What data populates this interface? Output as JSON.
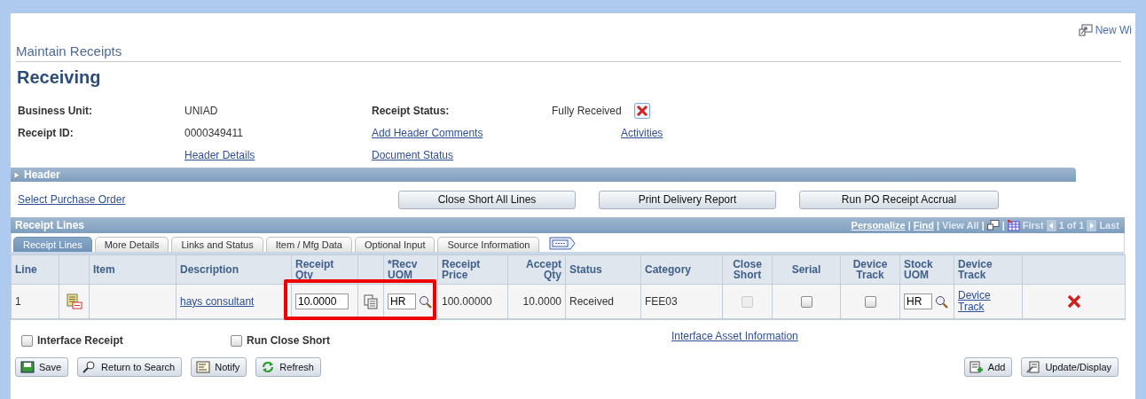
{
  "new_window": "New Wi",
  "breadcrumb": "Maintain Receipts",
  "title": "Receiving",
  "header_fields": {
    "business_unit": {
      "label": "Business Unit:",
      "value": "UNIAD"
    },
    "receipt_status": {
      "label": "Receipt Status:",
      "value": "Fully Received"
    },
    "receipt_id": {
      "label": "Receipt ID:",
      "value": "0000349411"
    },
    "add_header_comments": "Add Header Comments",
    "activities": "Activities",
    "header_details": "Header Details",
    "document_status": "Document Status"
  },
  "header_section": {
    "label": "Header",
    "expanded": false
  },
  "select_po": "Select Purchase Order",
  "action_buttons": [
    "Close Short All Lines",
    "Print Delivery Report",
    "Run PO Receipt Accrual"
  ],
  "grid": {
    "title": "Receipt Lines",
    "nav": [
      {
        "kind": "link",
        "text": "Personalize"
      },
      {
        "kind": "sep",
        "text": "|"
      },
      {
        "kind": "link",
        "text": "Find"
      },
      {
        "kind": "sep",
        "text": "|"
      },
      {
        "kind": "muted",
        "text": "View All"
      },
      {
        "kind": "sep",
        "text": "|"
      },
      {
        "kind": "zoom"
      },
      {
        "kind": "sep",
        "text": "|"
      },
      {
        "kind": "grid"
      },
      {
        "kind": "muted",
        "text": "First"
      },
      {
        "kind": "prev"
      },
      {
        "kind": "muted",
        "text": "1 of 1"
      },
      {
        "kind": "next"
      },
      {
        "kind": "muted",
        "text": "Last"
      }
    ],
    "tabs": [
      {
        "label": "Receipt Lines",
        "selected": true
      },
      {
        "label": "More Details",
        "selected": false
      },
      {
        "label": "Links and Status",
        "selected": false
      },
      {
        "label": "Item / Mfg Data",
        "selected": false
      },
      {
        "label": "Optional Input",
        "selected": false
      },
      {
        "label": "Source Information",
        "selected": false
      }
    ],
    "columns": [
      {
        "label": "Line"
      },
      {},
      {
        "label": "Item"
      },
      {
        "label": "Description"
      },
      {
        "label": "Receipt Qty"
      },
      {},
      {
        "label": "*Recv UOM"
      },
      {
        "label": "Receipt Price"
      },
      {
        "label": "Accept Qty"
      },
      {
        "label": "Status"
      },
      {
        "label": "Category"
      },
      {
        "label": "Close Short"
      },
      {
        "label": "Serial"
      },
      {
        "label": "Device Track"
      },
      {
        "label": "Stock UOM"
      },
      {
        "label": "Device Track"
      },
      {}
    ],
    "rows": [
      [
        {
          "kind": "text",
          "text": "1"
        },
        {
          "kind": "detail"
        },
        {
          "kind": "empty"
        },
        {
          "kind": "link",
          "text": "hays consultant"
        },
        {
          "kind": "input",
          "value": "10.0000"
        },
        {
          "kind": "copy"
        },
        {
          "kind": "lookup",
          "value": "HR"
        },
        {
          "kind": "text",
          "text": "100.00000"
        },
        {
          "kind": "text",
          "text": "10.0000"
        },
        {
          "kind": "text",
          "text": "Received"
        },
        {
          "kind": "text",
          "text": "FEE03"
        },
        {
          "kind": "checkbox",
          "checked": false,
          "disabled": true
        },
        {
          "kind": "checkbox",
          "checked": false,
          "disabled": false
        },
        {
          "kind": "checkbox",
          "checked": false,
          "disabled": false
        },
        {
          "kind": "lookup",
          "value": "HR"
        },
        {
          "kind": "link",
          "text": "Device Track"
        },
        {
          "kind": "delete"
        }
      ]
    ]
  },
  "options": [
    {
      "label": "Interface Receipt",
      "checked": false
    },
    {
      "label": "Run Close Short",
      "checked": false
    }
  ],
  "interface_asset": "Interface Asset Information",
  "bottom_left": [
    {
      "kind": "save",
      "label": "Save"
    },
    {
      "kind": "search",
      "label": "Return to Search"
    },
    {
      "kind": "notify",
      "label": "Notify"
    },
    {
      "kind": "refresh",
      "label": "Refresh"
    }
  ],
  "bottom_right": [
    {
      "kind": "add",
      "label": "Add"
    },
    {
      "kind": "update",
      "label": "Update/Display"
    }
  ]
}
